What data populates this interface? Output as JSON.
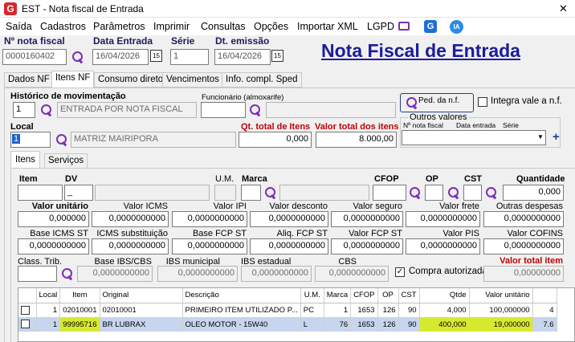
{
  "window": {
    "title": "EST - Nota fiscal de Entrada",
    "close": "✕"
  },
  "menu": [
    "Saída",
    "Cadastros",
    "Parâmetros",
    "Imprimir",
    "Consultas",
    "Opções",
    "Importar XML",
    "LGPD"
  ],
  "header": {
    "nota_label": "Nº nota fiscal",
    "nota_value": "0000160402",
    "data_label": "Data Entrada",
    "data_value": "16/04/2026",
    "serie_label": "Série",
    "serie_value": "1",
    "emissao_label": "Dt. emissão",
    "emissao_value": "16/04/2026",
    "big_title": "Nota Fiscal de Entrada",
    "cal_icon": "15"
  },
  "tabs": [
    "Dados NF",
    "Itens NF",
    "Consumo direto",
    "Vencimentos",
    "Info. compl. Sped"
  ],
  "top": {
    "historico_label": "Histórico de movimentação",
    "historico_code": "1",
    "historico_desc": "ENTRADA POR NOTA FISCAL",
    "funcionario_label": "Funcionário (almoxarife)",
    "funcionario_code": "",
    "funcionario_name": "",
    "ped_button": "Ped. da n.f.",
    "integra_label": "Integra vale a n.f.",
    "local_label": "Local",
    "local_code": "1",
    "local_desc": "MATRIZ MAIRIPORA",
    "qt_label": "Qt. total de Itens",
    "qt_value": "0,000",
    "vt_label": "Valor total dos itens",
    "vt_value": "8.000,00",
    "outros_label": "Outros valores",
    "outros_cols": [
      "Nº nota fiscal",
      "Data entrada",
      "Série"
    ],
    "plus": "+"
  },
  "subtabs": [
    "Itens",
    "Serviços"
  ],
  "item": {
    "item_label": "Item",
    "dv_label": "DV",
    "dv_value": "_",
    "um_label": "U.M.",
    "marca_label": "Marca",
    "cfop_label": "CFOP",
    "op_label": "OP",
    "cst_label": "CST",
    "qtd_label": "Quantidade",
    "qtd_value": "0,000"
  },
  "row1": [
    {
      "label": "Valor unitário",
      "value": "0,000000",
      "bold": true
    },
    {
      "label": "Valor ICMS",
      "value": "0,0000000000"
    },
    {
      "label": "Valor IPI",
      "value": "0,0000000000"
    },
    {
      "label": "Valor desconto",
      "value": "0,0000000000"
    },
    {
      "label": "Valor seguro",
      "value": "0,0000000000"
    },
    {
      "label": "Valor frete",
      "value": "0,0000000000"
    },
    {
      "label": "Outras despesas",
      "value": "0,0000000000"
    }
  ],
  "row2": [
    {
      "label": "Base ICMS ST",
      "value": "0,0000000000"
    },
    {
      "label": "ICMS substituição",
      "value": "0,0000000000"
    },
    {
      "label": "Base FCP ST",
      "value": "0,0000000000"
    },
    {
      "label": "Aliq. FCP ST",
      "value": "0,0000000000"
    },
    {
      "label": "Valor FCP ST",
      "value": "0,0000000000"
    },
    {
      "label": "Valor PIS",
      "value": "0,0000000000"
    },
    {
      "label": "Valor COFINS",
      "value": "0,0000000000"
    }
  ],
  "row3": {
    "class_label": "Class. Trib.",
    "class_value": "",
    "ibs_base_label": "Base IBS/CBS",
    "ibs_base_value": "0,0000000000",
    "ibs_mun_label": "IBS municipal",
    "ibs_mun_value": "0,0000000000",
    "ibs_est_label": "IBS estadual",
    "ibs_est_value": "0,0000000000",
    "cbs_label": "CBS",
    "cbs_value": "0,0000000000",
    "compra_label": "Compra autorizada",
    "check": "✓",
    "vti_label": "Valor total item",
    "vti_value": "0,00000000"
  },
  "grid": {
    "columns": [
      "",
      "Local",
      "Item",
      "Original",
      "Descrição",
      "U.M.",
      "Marca",
      "CFOP",
      "OP",
      "CST",
      "Qtde",
      "Valor unitário",
      ""
    ],
    "rows": [
      [
        "",
        "1",
        "02010001",
        "02010001",
        "PRIMEIRO ITEM UTILIZADO P...",
        "PC",
        "1",
        "1653",
        "126",
        "90",
        "4,000",
        "100,000000",
        "4"
      ],
      [
        "",
        "1",
        "99995716",
        "BR LUBRAX",
        "OLEO MOTOR - 15W40",
        "L",
        "76",
        "1653",
        "126",
        "90",
        "400,000",
        "19,000000",
        "7.6"
      ]
    ]
  },
  "colors": {
    "accent": "#7a2fb5",
    "title_blue": "#1c1c9c",
    "highlight": "#d7e92f",
    "selection": "#c7d5ee"
  }
}
